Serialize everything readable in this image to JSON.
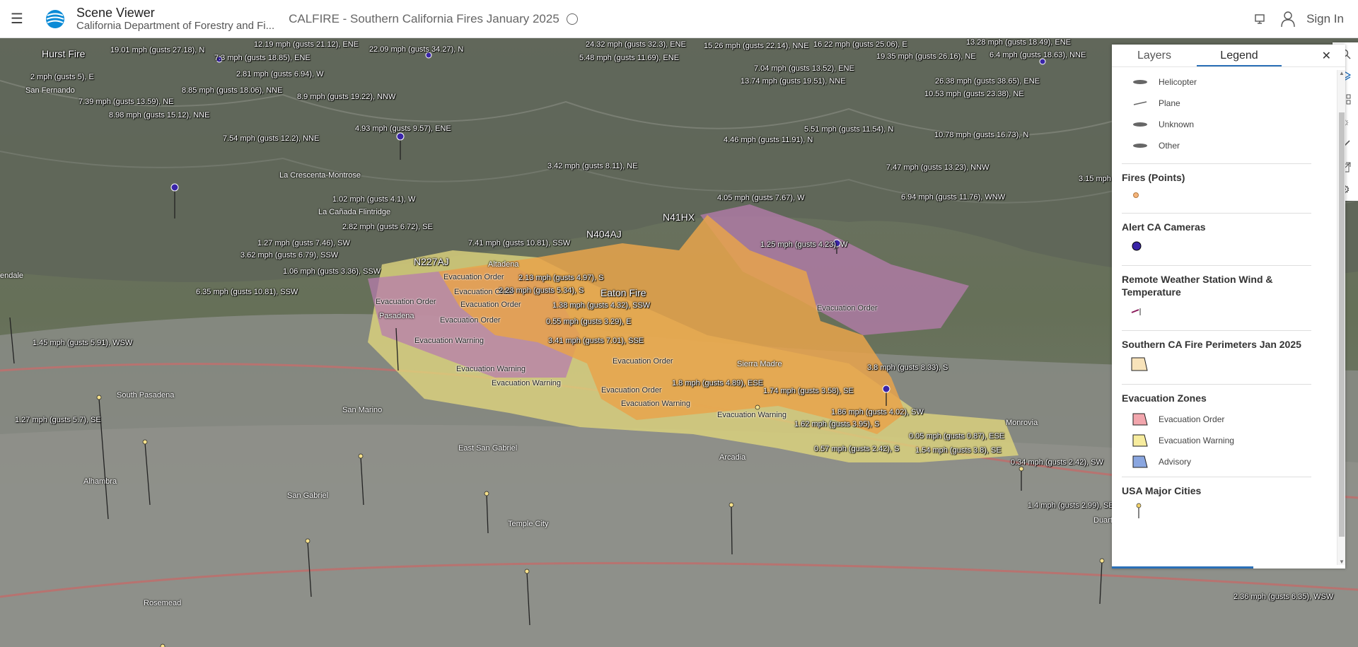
{
  "header": {
    "app_title": "Scene Viewer",
    "app_subtitle": "California Department of Forestry and Fi...",
    "scene_title": "CALFIRE - Southern California Fires January 2025",
    "sign_in": "Sign In"
  },
  "panel": {
    "tabs": [
      "Layers",
      "Legend"
    ],
    "active_tab": "Legend",
    "aircraft_items": [
      "Helicopter",
      "Plane",
      "Unknown",
      "Other"
    ],
    "fires_title": "Fires (Points)",
    "cameras_title": "Alert CA Cameras",
    "weather_title": "Remote Weather Station Wind & Temperature",
    "perimeters_title": "Southern CA Fire Perimeters Jan 2025",
    "evac_title": "Evacuation Zones",
    "evac_items": [
      {
        "label": "Evacuation Order",
        "color": "#f2a6ad"
      },
      {
        "label": "Evacuation Warning",
        "color": "#f7ec9e"
      },
      {
        "label": "Advisory",
        "color": "#8aa6e0"
      }
    ],
    "cities_title": "USA Major Cities"
  },
  "map": {
    "fire_names": [
      "Eaton Fire",
      "Hurst Fire"
    ],
    "aircraft_labels": [
      "N41HX",
      "N404AJ",
      "N227AJ"
    ],
    "cities": [
      "San Fernando",
      "La Crescenta-Montrose",
      "La Cañada Flintridge",
      "Pasadena",
      "South Pasadena",
      "San Marino",
      "East San Gabriel",
      "Arcadia",
      "Sierra Madre",
      "Altadena",
      "Alhambra",
      "San Gabriel",
      "Temple City",
      "Rosemead",
      "Monrovia",
      "Duarte",
      "endale"
    ],
    "zone_labels": [
      "Evacuation Order",
      "Evacuation Warning"
    ],
    "wind": [
      "12.19 mph (gusts 21.12), ENE",
      "19.01 mph (gusts 27.18), N",
      "7.3 mph (gusts 18.85), ENE",
      "22.09 mph (gusts 34.27), N",
      "24.32 mph (gusts 32.3), ENE",
      "15.26 mph (gusts 22.14), NNE",
      "16.22 mph (gusts 25.06), E",
      "13.28 mph (gusts 18.49), ENE",
      "5.48 mph (gusts 11.69), ENE",
      "19.35 mph (gusts 26.16), NE",
      "6.4 mph (gusts 18.63), NNE",
      "2 mph (gusts 5), E",
      "2.81 mph (gusts 6.94), W",
      "7.04 mph (gusts 13.52), ENE",
      "13.74 mph (gusts 19.51), NNE",
      "26.38 mph (gusts 38.65), ENE",
      "8.85 mph (gusts 18.06), NNE",
      "8.9 mph (gusts 19.22), NNW",
      "10.53 mph (gusts 23.38), NE",
      "7.39 mph (gusts 13.59), NE",
      "8.98 mph (gusts 15.12), NNE",
      "4.93 mph (gusts 9.57), ENE",
      "5.51 mph (gusts 11.54), N",
      "10.78 mph (gusts 16.73), N",
      "7.54 mph (gusts 12.2), NNE",
      "4.46 mph (gusts 11.91), N",
      "3.42 mph (gusts 8.11), NE",
      "7.47 mph (gusts 13.23), NNW",
      "3.15 mph",
      "4.05 mph (gusts 7.67), W",
      "6.94 mph (gusts 11.76), WNW",
      "1.02 mph (gusts 4.1), W",
      "2.82 mph (gusts 6.72), SE",
      "1.27 mph (gusts 7.46), SW",
      "7.41 mph (gusts 10.81), SSW",
      "1.25 mph (gusts 4.23), W",
      "3.62 mph (gusts 6.79), SSW",
      "1.06 mph (gusts 3.36), SSW",
      "2.13 mph (gusts 4.97), S",
      "2.23 mph (gusts 5.34), S",
      "6.35 mph (gusts 10.81), SSW",
      "1.38 mph (gusts 4.32), SSW",
      "0.55 mph (gusts 3.29), E",
      "1.45 mph (gusts 5.91), WSW",
      "3.41 mph (gusts 7.01), SSE",
      "3.8 mph (gusts 8.33), S",
      "1.8 mph (gusts 4.89), ESE",
      "1.74 mph (gusts 3.58), SE",
      "1.27 mph (gusts 5.7), SE",
      "1.86 mph (gusts 4.02), SW",
      "1.62 mph (gusts 3.95), S",
      "0.05 mph (gusts 0.87), ESE",
      "0.57 mph (gusts 2.42), S",
      "1.54 mph (gusts 3.8), SE",
      "0.34 mph (gusts 2.42), SW",
      "1.4 mph (gusts 2.99), SE",
      "SW",
      "2.36 mph (gusts 6.35), WSW"
    ]
  }
}
